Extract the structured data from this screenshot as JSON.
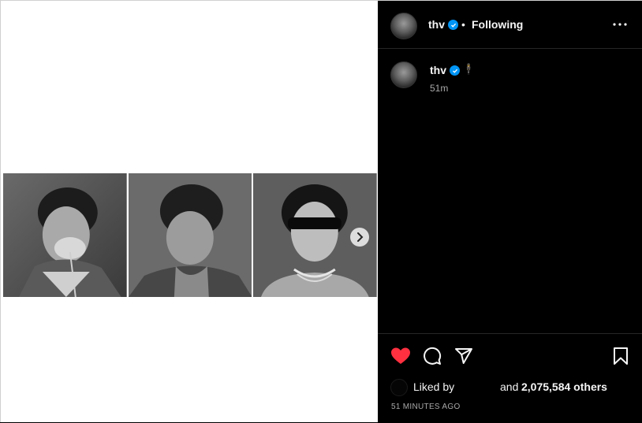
{
  "post": {
    "photos": [
      {
        "name": "photo-with-flower"
      },
      {
        "name": "photo-head-tilted"
      },
      {
        "name": "photo-sunglasses"
      }
    ],
    "next_icon": "chevron-right-icon"
  },
  "header": {
    "username": "thv",
    "separator": "•",
    "follow_status": "Following",
    "more_icon": "ellipsis-icon"
  },
  "caption": {
    "username": "thv",
    "emoji": "🕴",
    "time": "51m"
  },
  "actions": {
    "like_icon": "heart-filled-icon",
    "comment_icon": "comment-icon",
    "share_icon": "send-icon",
    "save_icon": "bookmark-icon",
    "like_color": "#ff3040"
  },
  "likes": {
    "prefix": "Liked by",
    "and": "and",
    "count": "2,075,584 others"
  },
  "time_ago": "51 MINUTES AGO"
}
